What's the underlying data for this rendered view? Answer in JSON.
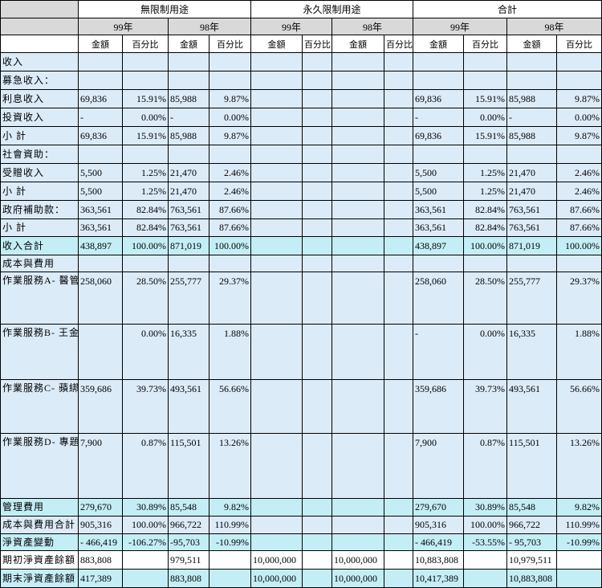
{
  "header": {
    "groups": [
      "無限制用途",
      "永久限制用途",
      "合計"
    ],
    "years": [
      "99年",
      "98年",
      "99年",
      "98年",
      "99年",
      "98年"
    ],
    "cols": [
      "金額",
      "百分比",
      "金額",
      "百分比",
      "金額",
      "百分比",
      "金額",
      "百分比",
      "金額",
      "百分比",
      "金額",
      "百分比"
    ]
  },
  "rows": [
    {
      "label": "收入",
      "cls": "bl",
      "h": 22,
      "cells": [
        "",
        "",
        "",
        "",
        "",
        "",
        "",
        "",
        "",
        "",
        "",
        ""
      ]
    },
    {
      "label": " 募急收入：",
      "cls": "bl",
      "h": 22,
      "cells": [
        "",
        "",
        "",
        "",
        "",
        "",
        "",
        "",
        "",
        "",
        "",
        ""
      ]
    },
    {
      "label": "   利息收入",
      "cls": "bl",
      "h": 22,
      "cells": [
        "69,836",
        "15.91%",
        "85,988",
        "9.87%",
        "",
        "",
        "",
        "",
        "69,836",
        "15.91%",
        "85,988",
        "9.87%"
      ]
    },
    {
      "label": "   投資收入",
      "cls": "bl",
      "h": 22,
      "cells": [
        "-",
        "0.00%",
        "-",
        "0.00%",
        "",
        "",
        "",
        "",
        "-",
        "0.00%",
        "-",
        "0.00%"
      ]
    },
    {
      "label": "   小  計",
      "cls": "bl",
      "h": 22,
      "cells": [
        "69,836",
        "15.91%",
        "85,988",
        "9.87%",
        "",
        "",
        "",
        "",
        "69,836",
        "15.91%",
        "85,988",
        "9.87%"
      ]
    },
    {
      "label": " 社會資助：",
      "cls": "bl",
      "h": 22,
      "cells": [
        "",
        "",
        "",
        "",
        "",
        "",
        "",
        "",
        "",
        "",
        "",
        ""
      ]
    },
    {
      "label": "   受贈收入",
      "cls": "bl",
      "h": 22,
      "cells": [
        "5,500",
        "1.25%",
        "21,470",
        "2.46%",
        "",
        "",
        "",
        "",
        "5,500",
        "1.25%",
        "21,470",
        "2.46%"
      ]
    },
    {
      "label": "   小  計",
      "cls": "bl",
      "h": 22,
      "cells": [
        "5,500",
        "1.25%",
        "21,470",
        "2.46%",
        "",
        "",
        "",
        "",
        "5,500",
        "1.25%",
        "21,470",
        "2.46%"
      ]
    },
    {
      "label": " 政府補助款：",
      "cls": "bl",
      "h": 22,
      "cells": [
        "363,561",
        "82.84%",
        "763,561",
        "87.66%",
        "",
        "",
        "",
        "",
        "363,561",
        "82.84%",
        "763,561",
        "87.66%"
      ]
    },
    {
      "label": "  小  計",
      "cls": "bl",
      "h": 21,
      "cells": [
        "363,561",
        "82.84%",
        "763,561",
        "87.66%",
        "",
        "",
        "",
        "",
        "363,561",
        "82.84%",
        "763,561",
        "87.66%"
      ]
    },
    {
      "label": "收入合計",
      "cls": "cy",
      "h": 22,
      "cells": [
        "438,897",
        "100.00%",
        "871,019",
        "100.00%",
        "",
        "",
        "",
        "",
        "438,897",
        "100.00%",
        "871,019",
        "100.00%"
      ]
    },
    {
      "label": "成本與費用",
      "cls": "bl",
      "h": 20,
      "cells": [
        "",
        "",
        "",
        "",
        "",
        "",
        "",
        "",
        "",
        "",
        "",
        ""
      ]
    },
    {
      "label": "  作業服務A-\n    醫管獎學金",
      "cls": "bl",
      "h": 60,
      "tall": true,
      "cells": [
        "258,060",
        "28.50%",
        "255,777",
        "29.37%",
        "",
        "",
        "",
        "",
        "258,060",
        "28.50%",
        "255,777",
        "29.37%"
      ]
    },
    {
      "label": "  作業服務B-\n    王金茂醫管\n    論文獎",
      "cls": "bl",
      "h": 64,
      "tall": true,
      "cells": [
        "",
        "0.00%",
        "16,335",
        "1.88%",
        "",
        "",
        "",
        "",
        "-",
        "0.00%",
        "16,335",
        "1.88%"
      ]
    },
    {
      "label": "  作業服務C-\n    蘋綁計畫",
      "cls": "bl",
      "h": 62,
      "tall": true,
      "cells": [
        "359,686",
        "39.73%",
        "493,561",
        "56.66%",
        "",
        "",
        "",
        "",
        "359,686",
        "39.73%",
        "493,561",
        "56.66%"
      ]
    },
    {
      "label": "  作業服務D-\n    專題演講",
      "cls": "bl",
      "h": 76,
      "tall": true,
      "cells": [
        "7,900",
        "0.87%",
        "115,501",
        "13.26%",
        "",
        "",
        "",
        "",
        "7,900",
        "0.87%",
        "115,501",
        "13.26%"
      ]
    },
    {
      "label": "  管理費用",
      "cls": "cy",
      "h": 21,
      "cells": [
        "279,670",
        "30.89%",
        "85,548",
        "9.82%",
        "",
        "",
        "",
        "",
        "279,670",
        "30.89%",
        "85,548",
        "9.82%"
      ]
    },
    {
      "label": "成本與費用合計",
      "cls": "bl",
      "h": 21,
      "cells": [
        "905,316",
        "100.00%",
        "966,722",
        "110.99%",
        "",
        "",
        "",
        "",
        "905,316",
        "100.00%",
        "966,722",
        "110.99%"
      ]
    },
    {
      "label": "淨資產變動",
      "cls": "cy",
      "h": 20,
      "cells": [
        "- 466,419",
        "-106.27%",
        "-95,703",
        "-10.99%",
        "",
        "",
        "",
        "",
        "- 466,419",
        "-53.55%",
        "-  95,703",
        "-10.99%"
      ]
    },
    {
      "label": "期初淨資產餘額",
      "cls": "wh",
      "h": 22,
      "cells": [
        "883,808",
        "",
        "979,511",
        "",
        "10,000,000",
        "",
        "10,000,000",
        "",
        "10,883,808",
        "",
        "10,979,511",
        ""
      ]
    },
    {
      "label": "期末淨資產餘額",
      "cls": "cy",
      "h": 22,
      "cells": [
        "417,389",
        "",
        "883,808",
        "",
        "10,000,000",
        "",
        "10,000,000",
        "",
        "10,417,389",
        "",
        "10,883,808",
        ""
      ]
    }
  ]
}
